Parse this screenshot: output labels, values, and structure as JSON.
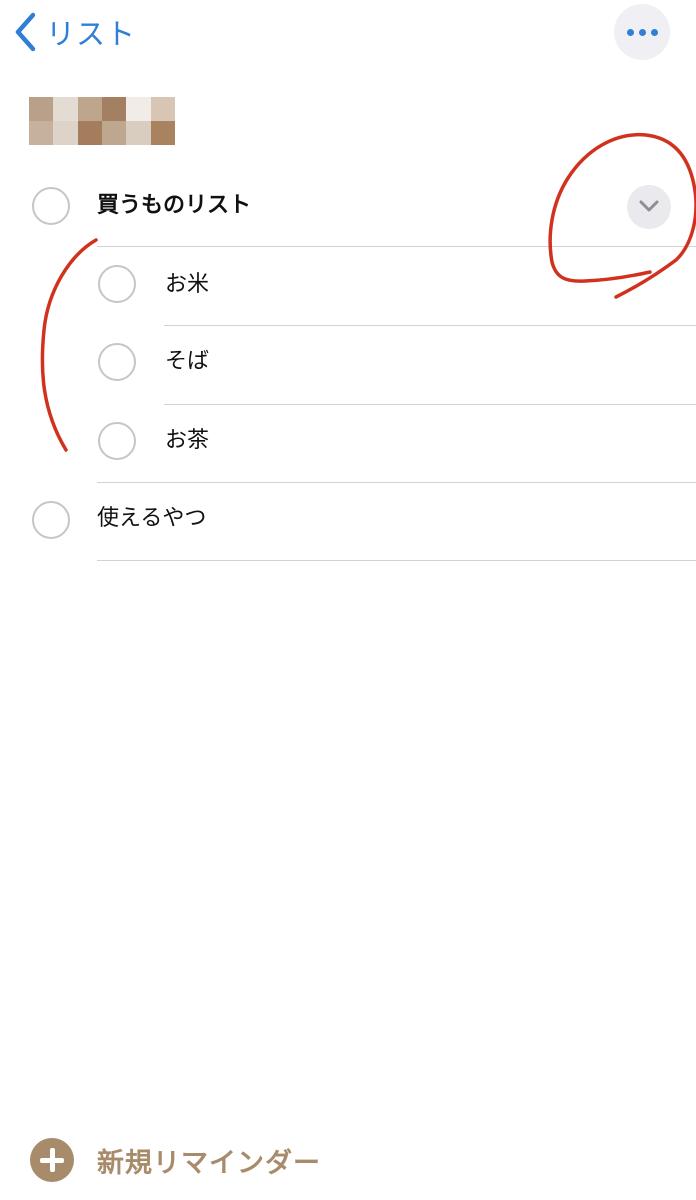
{
  "nav": {
    "back_label": "リスト",
    "back_icon": "chevron-left-icon",
    "more_icon": "ellipsis-icon"
  },
  "colors": {
    "accent_blue": "#2f7ed8",
    "list_color": "#a88b6a",
    "annotation_red": "#d0321e",
    "separator": "#d1d1d6",
    "circle_border": "#c6c6c8"
  },
  "list": {
    "title_redacted": true,
    "title_pixels": [
      "#b9a089",
      "#e4dbd2",
      "#bea68c",
      "#a48062",
      "#f1ece7",
      "#d8c6b4",
      "#c5b19c",
      "#ded3c9",
      "#a47e5c",
      "#bda78e",
      "#d9cdc0",
      "#a9835f"
    ]
  },
  "reminders": [
    {
      "title": "買うものリスト",
      "bold": true,
      "expanded": true,
      "chevron_icon": "chevron-down-icon",
      "subtasks": [
        {
          "title": "お米"
        },
        {
          "title": "そば"
        },
        {
          "title": "お茶"
        }
      ]
    },
    {
      "title": "使えるやつ",
      "bold": false
    }
  ],
  "footer": {
    "new_reminder_label": "新規リマインダー",
    "plus_icon": "plus-circle-icon"
  }
}
